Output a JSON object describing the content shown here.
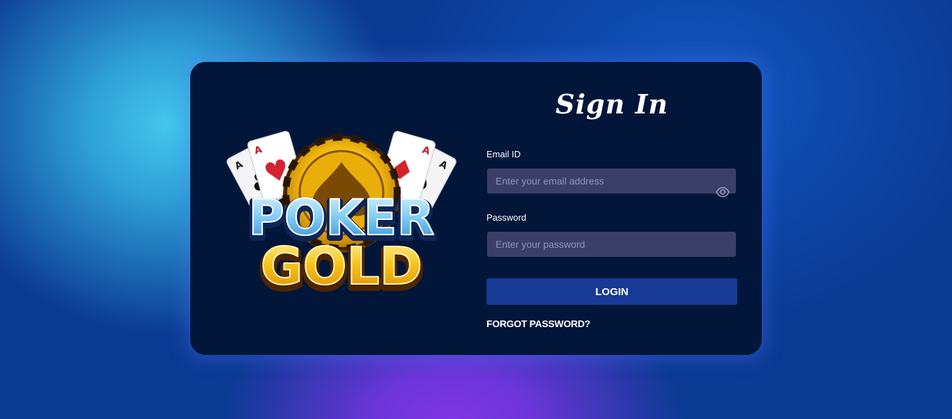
{
  "logo": {
    "line1": "POKER",
    "line2": "GOLD",
    "card_rank": "A"
  },
  "signin": {
    "title": "Sign In",
    "email_label": "Email ID",
    "email_placeholder": "Enter your email address",
    "email_value": "",
    "password_label": "Password",
    "password_placeholder": "Enter your password",
    "password_value": "",
    "login_label": "LOGIN",
    "forgot_label": "FORGOT PASSWORD?"
  },
  "icons": {
    "password_toggle": "eye-icon"
  },
  "colors": {
    "card_bg": "#02163a",
    "input_bg": "#3a3f6a",
    "button_bg": "#173a96",
    "gold": "#f6c21a",
    "poker_blue": "#6cc6f2"
  }
}
